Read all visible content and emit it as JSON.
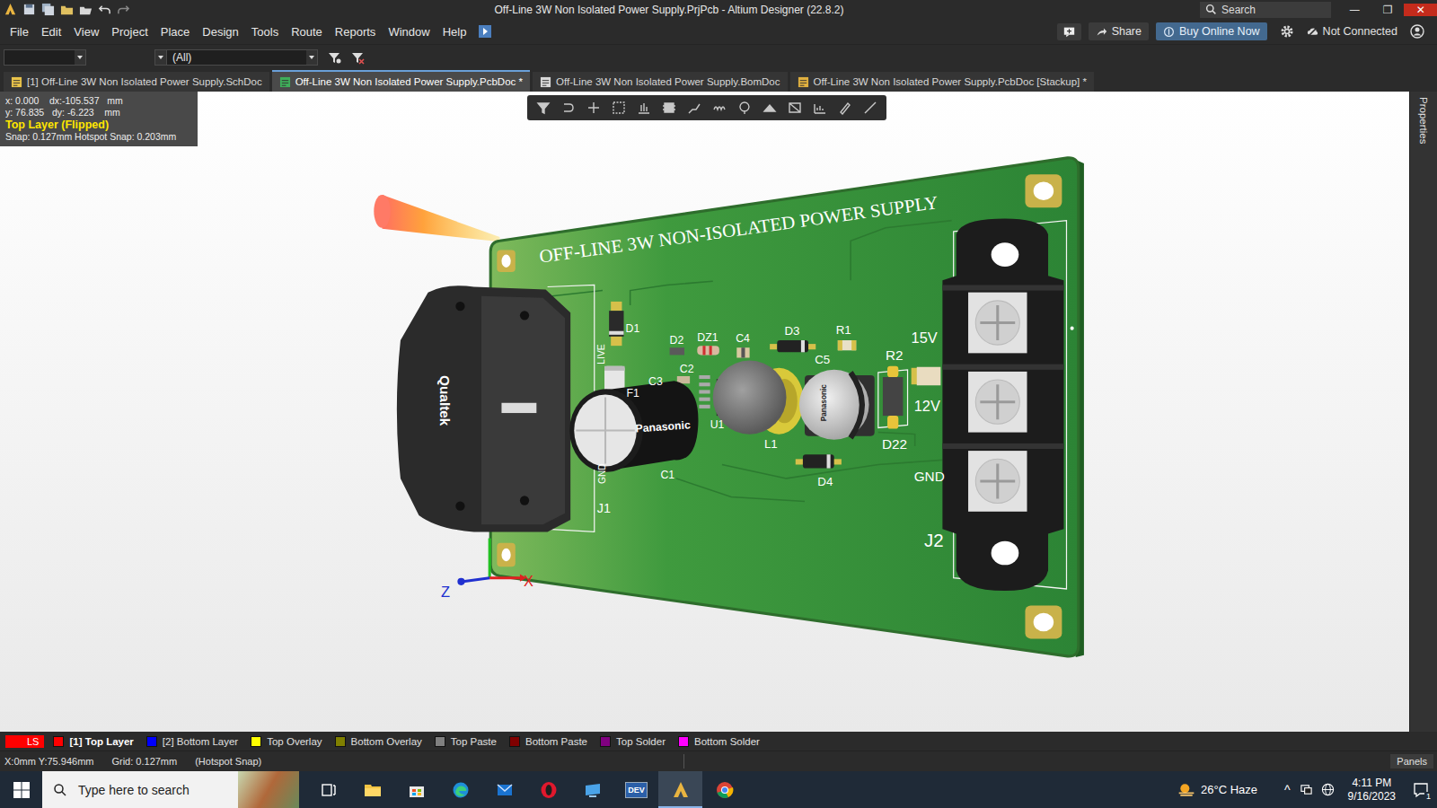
{
  "window": {
    "title": "Off-Line 3W Non Isolated Power Supply.PrjPcb - Altium Designer (22.8.2)",
    "search": "Search",
    "controls": [
      "—",
      "❐",
      "✕"
    ]
  },
  "menu": [
    "File",
    "Edit",
    "View",
    "Project",
    "Place",
    "Design",
    "Tools",
    "Route",
    "Reports",
    "Window",
    "Help"
  ],
  "menu_right": {
    "share": "Share",
    "buy": "Buy Online Now",
    "connection": "Not Connected"
  },
  "toolbar": {
    "filter": "(All)"
  },
  "doc_tabs": [
    {
      "label": "[1] Off-Line 3W Non Isolated Power Supply.SchDoc",
      "selected": false,
      "kind": "sch"
    },
    {
      "label": "Off-Line 3W Non Isolated Power Supply.PcbDoc *",
      "selected": true,
      "kind": "pcb"
    },
    {
      "label": "Off-Line 3W Non Isolated Power Supply.BomDoc",
      "selected": false,
      "kind": "bom"
    },
    {
      "label": "Off-Line 3W Non Isolated Power Supply.PcbDoc [Stackup] *",
      "selected": false,
      "kind": "stack"
    }
  ],
  "side_panel": "Properties",
  "heads_up": {
    "lines": [
      "x: 0.000    dx:-105.537   mm",
      "y: 76.835   dy: -6.223    mm"
    ],
    "layer": "Top Layer (Flipped)",
    "snap": "Snap: 0.127mm Hotspot Snap: 0.203mm"
  },
  "board": {
    "title": "OFF-LINE 3W NON-ISOLATED POWER SUPPLY",
    "designators": [
      "D1",
      "D2",
      "DZ1",
      "C4",
      "D3",
      "R1",
      "C5",
      "R2",
      "15V",
      "12V",
      "GND",
      "C3",
      "C2",
      "F1",
      "U1",
      "L1",
      "D22",
      "D4",
      "C1",
      "J1",
      "J2",
      "LIVE",
      "GND"
    ],
    "model_labels": [
      "Qualtek",
      "Panasonic",
      "Panasonic"
    ],
    "axes": [
      "Z",
      "X"
    ]
  },
  "layers": [
    {
      "label": "LS",
      "color": "#ff0000",
      "selected": false,
      "kind": "ls"
    },
    {
      "label": "[1] Top Layer",
      "color": "#ff0000",
      "selected": true,
      "kind": "layer"
    },
    {
      "label": "[2] Bottom Layer",
      "color": "#0000ff",
      "selected": false,
      "kind": "layer"
    },
    {
      "label": "Top Overlay",
      "color": "#ffff00",
      "selected": false,
      "kind": "layer"
    },
    {
      "label": "Bottom Overlay",
      "color": "#808000",
      "selected": false,
      "kind": "layer"
    },
    {
      "label": "Top Paste",
      "color": "#808080",
      "selected": false,
      "kind": "layer"
    },
    {
      "label": "Bottom Paste",
      "color": "#800000",
      "selected": false,
      "kind": "layer"
    },
    {
      "label": "Top Solder",
      "color": "#800080",
      "selected": false,
      "kind": "layer"
    },
    {
      "label": "Bottom Solder",
      "color": "#ff00ff",
      "selected": false,
      "kind": "layer"
    }
  ],
  "status_bar": {
    "position": "X:0mm Y:75.946mm",
    "grid": "Grid: 0.127mm",
    "snap": "(Hotspot Snap)",
    "panels": "Panels"
  },
  "taskbar": {
    "search": "Type here to search",
    "dev_badge": "DEV",
    "weather": "26°C Haze",
    "tray_chevron": "^",
    "time": "4:11 PM",
    "date": "9/16/2023",
    "notifications": "1"
  }
}
